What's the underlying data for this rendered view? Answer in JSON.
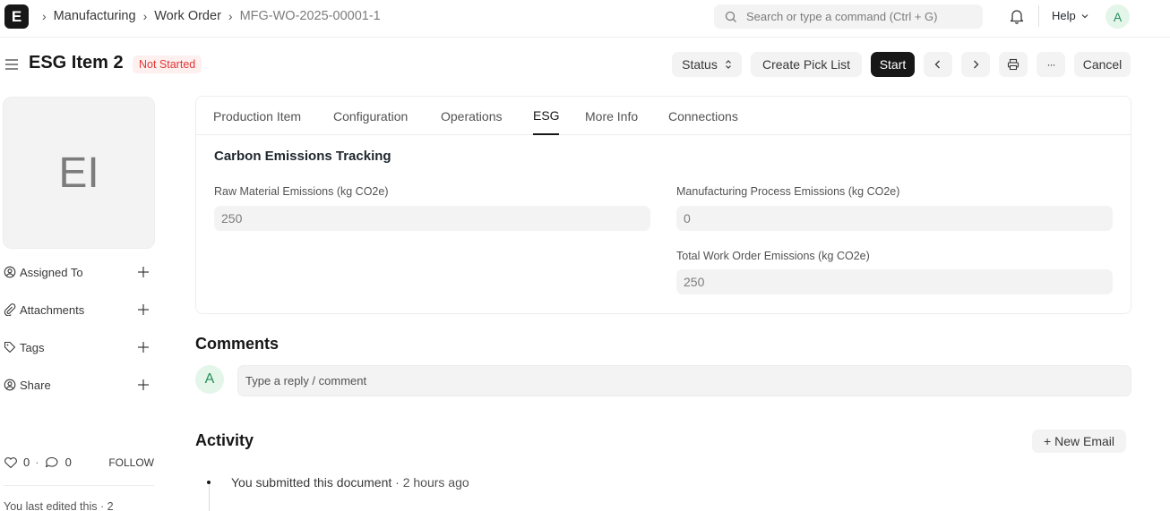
{
  "navbar": {
    "logo_letter": "E",
    "breadcrumbs": [
      "Manufacturing",
      "Work Order",
      "MFG-WO-2025-00001-1"
    ],
    "search_placeholder": "Search or type a command (Ctrl + G)",
    "help_label": "Help",
    "user_initial": "A"
  },
  "page": {
    "title": "ESG Item 2",
    "status": "Not Started",
    "buttons": {
      "status": "Status",
      "create_pick_list": "Create Pick List",
      "start": "Start",
      "more": "···",
      "cancel": "Cancel"
    }
  },
  "sidebar": {
    "avatar_initials": "EI",
    "items": [
      {
        "label": "Assigned To",
        "icon": "assign-icon"
      },
      {
        "label": "Attachments",
        "icon": "paperclip-icon"
      },
      {
        "label": "Tags",
        "icon": "tag-icon"
      },
      {
        "label": "Share",
        "icon": "share-icon"
      }
    ],
    "likes": "0",
    "comments": "0",
    "separator": "·",
    "follow_label": "FOLLOW",
    "last_edited": "You last edited this · 2"
  },
  "tabs": [
    "Production Item",
    "Configuration",
    "Operations",
    "ESG",
    "More Info",
    "Connections"
  ],
  "active_tab": "ESG",
  "esg": {
    "section_title": "Carbon Emissions Tracking",
    "raw_material_label": "Raw Material Emissions (kg CO2e)",
    "raw_material_value": "250",
    "manufacturing_label": "Manufacturing Process Emissions (kg CO2e)",
    "manufacturing_value": "0",
    "total_label": "Total Work Order Emissions (kg CO2e)",
    "total_value": "250"
  },
  "comments": {
    "title": "Comments",
    "avatar_initial": "A",
    "placeholder": "Type a reply / comment"
  },
  "activity": {
    "title": "Activity",
    "new_email_label": "+ New Email",
    "items": [
      {
        "text": "You submitted this document",
        "separator": " · ",
        "time": "2 hours ago"
      }
    ]
  },
  "colors": {
    "status_text": "#e03636",
    "status_bg": "#fff0f0",
    "primary_button": "#171717",
    "avatar_bg": "#e4f5e9",
    "avatar_text": "#278f5e"
  }
}
